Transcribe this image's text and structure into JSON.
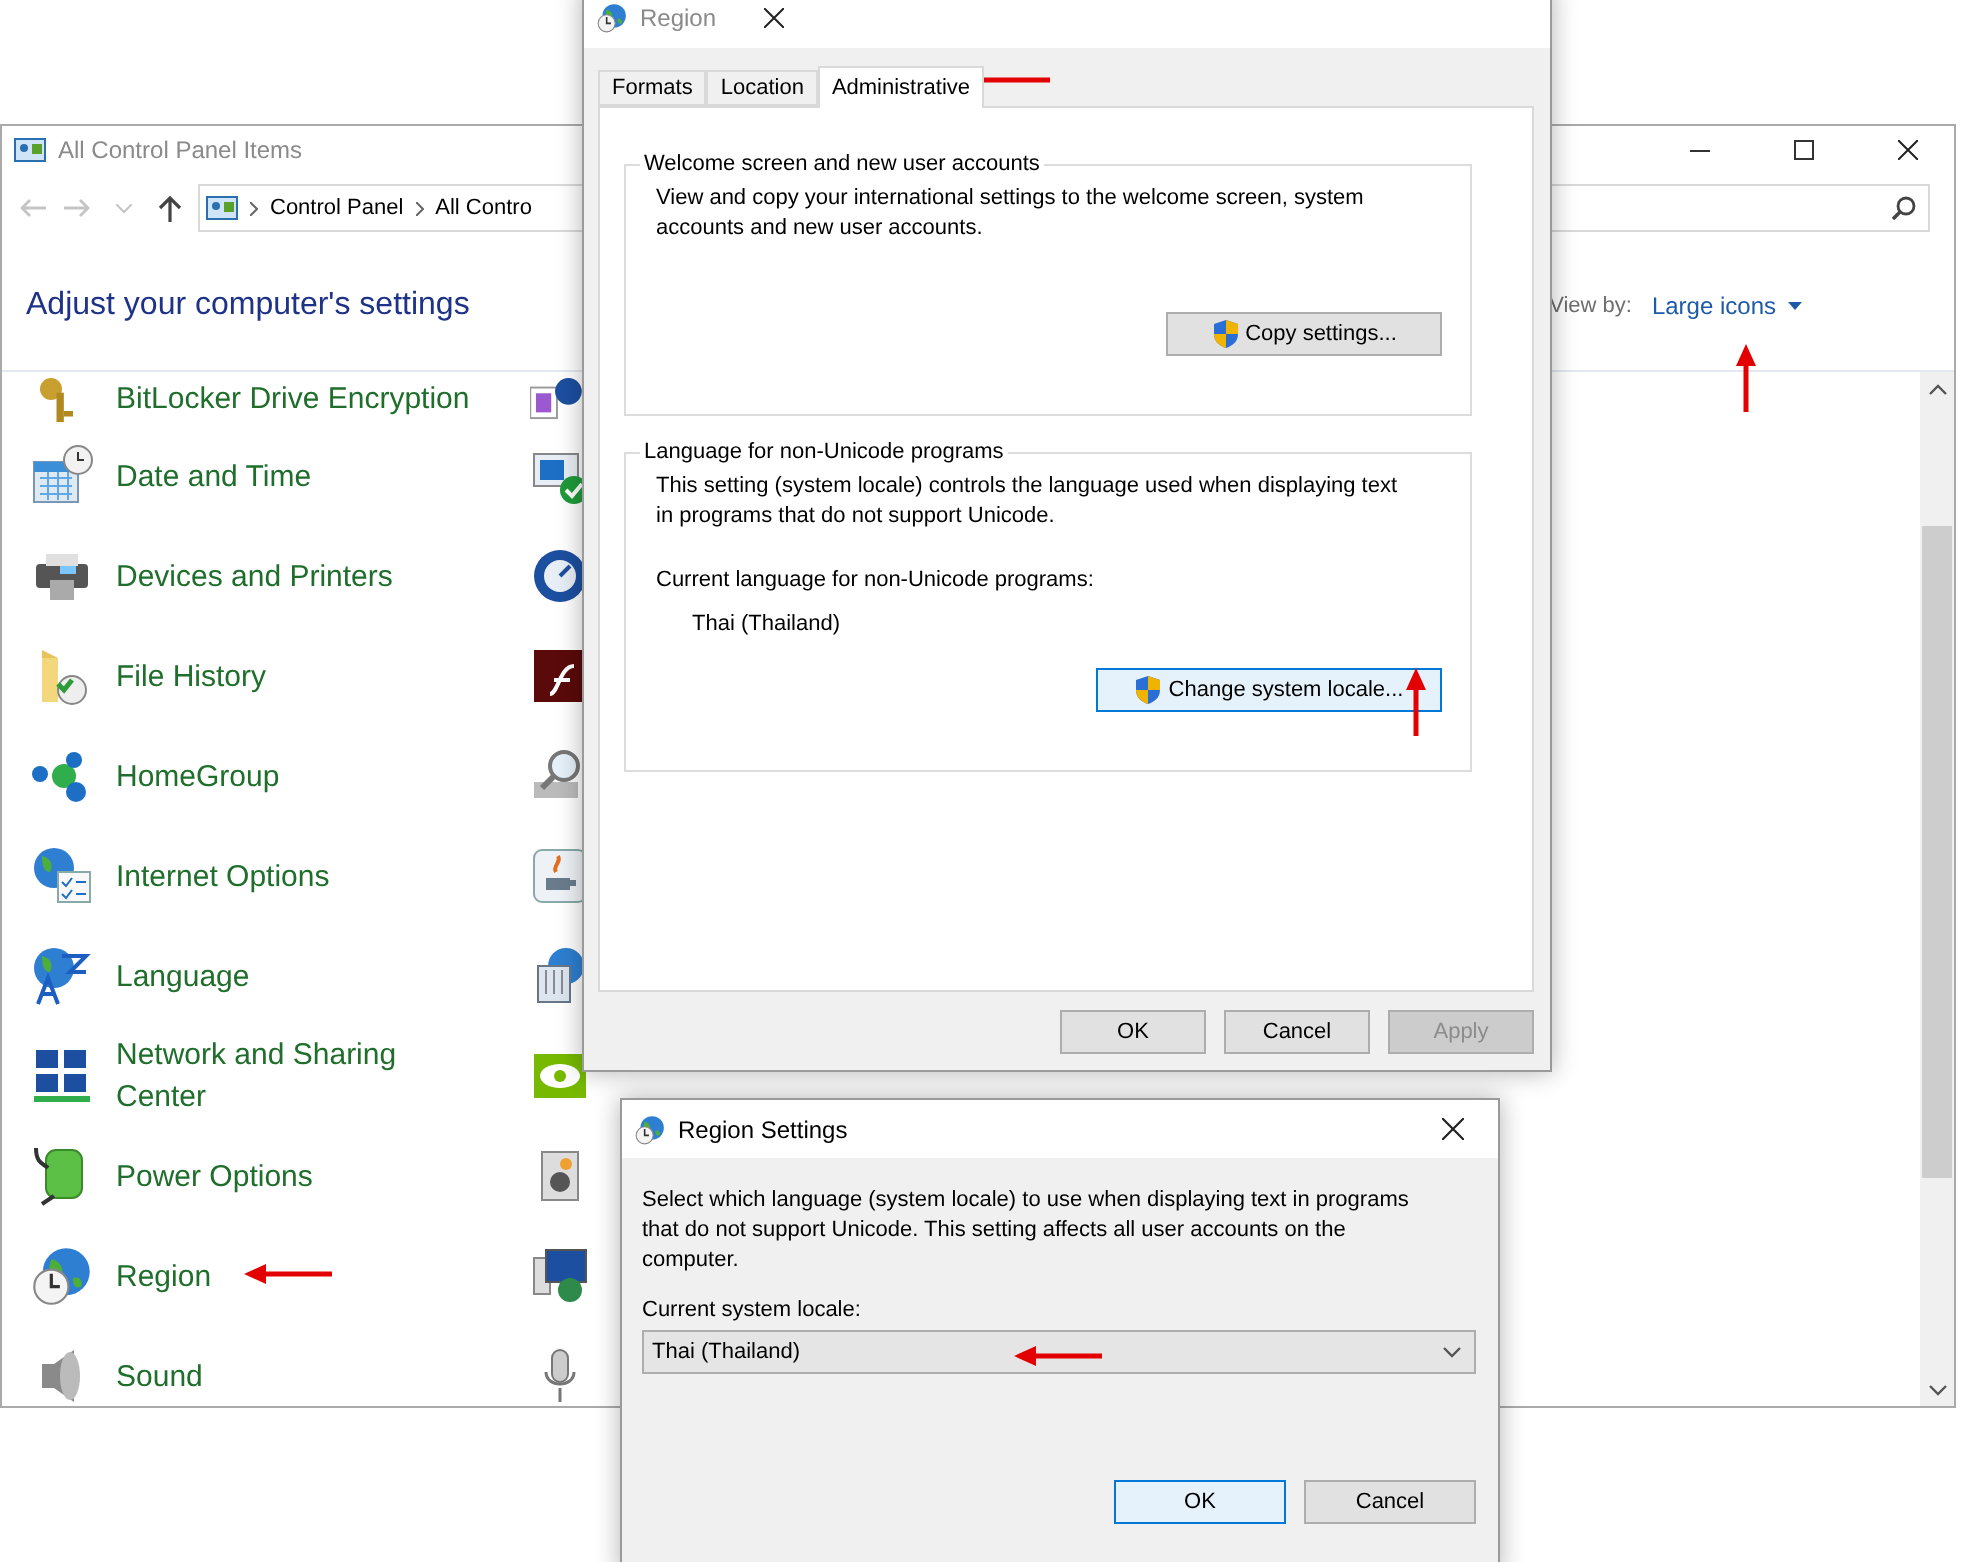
{
  "control_panel": {
    "title": "All Control Panel Items",
    "breadcrumb": [
      "Control Panel",
      "All Contro"
    ],
    "heading": "Adjust your computer's settings",
    "view_by_label": "View by:",
    "view_by_value": "Large icons",
    "rows": [
      {
        "label": "BitLocker Drive Encryption"
      },
      {
        "label": "Date and Time"
      },
      {
        "label": "Devices and Printers"
      },
      {
        "label": "File History"
      },
      {
        "label": "HomeGroup"
      },
      {
        "label": "Internet Options"
      },
      {
        "label": "Language"
      },
      {
        "label": "Network and Sharing Center"
      },
      {
        "label": "Power Options"
      },
      {
        "label": "Region"
      },
      {
        "label": "Sound"
      }
    ]
  },
  "region_dialog": {
    "title": "Region",
    "tabs": [
      {
        "label": "Formats",
        "selected": false
      },
      {
        "label": "Location",
        "selected": false
      },
      {
        "label": "Administrative",
        "selected": true
      }
    ],
    "groups": [
      {
        "title": "Welcome screen and new user accounts",
        "text": "View and copy your international settings to the welcome screen, system accounts and new user accounts.",
        "button": {
          "label": "Copy settings...",
          "focused": false
        }
      },
      {
        "title": "Language for non-Unicode programs",
        "text": "This setting (system locale) controls the language used when displaying text in programs that do not support Unicode.",
        "current_label": "Current language for non-Unicode programs:",
        "current_value": "Thai (Thailand)",
        "button": {
          "label": "Change system locale...",
          "focused": true
        }
      }
    ],
    "buttons": [
      {
        "label": "OK",
        "disabled": false
      },
      {
        "label": "Cancel",
        "disabled": false
      },
      {
        "label": "Apply",
        "disabled": true
      }
    ]
  },
  "region_settings": {
    "title": "Region Settings",
    "text": "Select which language (system locale) to use when displaying text in programs that do not support Unicode. This setting affects all user accounts on the computer.",
    "locale_label": "Current system locale:",
    "locale_value": "Thai (Thailand)",
    "buttons": [
      {
        "label": "OK",
        "default": true
      },
      {
        "label": "Cancel",
        "default": false
      }
    ]
  }
}
